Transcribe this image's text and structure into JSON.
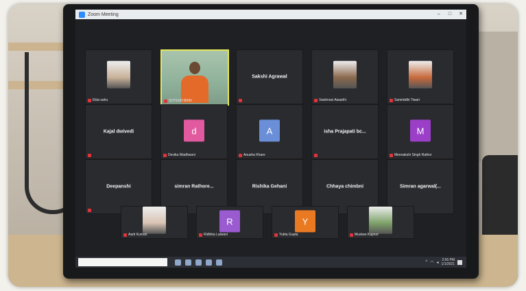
{
  "window": {
    "title": "Zoom Meeting",
    "controls": [
      "–",
      "□",
      "✕"
    ]
  },
  "participants": [
    {
      "name": "Ekta sahu",
      "type": "photo",
      "color": "#c9b29a"
    },
    {
      "name": "SOTESH BAIN",
      "type": "video",
      "active": true
    },
    {
      "name": "Sakshi Agrawal",
      "type": "name"
    },
    {
      "name": "Vaishnavi Awasthi",
      "type": "photo",
      "color": "#8b6a4e"
    },
    {
      "name": "Samriddhi Tiwari",
      "type": "photo",
      "color": "#c86b3c"
    },
    {
      "name": "Kajal dwivedi",
      "type": "name"
    },
    {
      "name": "Devika Wadhwani",
      "type": "avatar",
      "letter": "d",
      "color": "#e15aa0"
    },
    {
      "name": "Anusha Khare",
      "type": "avatar",
      "letter": "A",
      "color": "#6a8fd8"
    },
    {
      "name": "isha Prajapati bc...",
      "type": "name"
    },
    {
      "name": "Meenakshi Singh Rathor",
      "type": "avatar",
      "letter": "M",
      "color": "#9b3fc8"
    },
    {
      "name": "Deepanshi",
      "type": "name"
    },
    {
      "name": "simran Rathore...",
      "type": "name"
    },
    {
      "name": "Rishika Gehani",
      "type": "name"
    },
    {
      "name": "Chhaya chimbni",
      "type": "name"
    },
    {
      "name": "Simran agarwal(...",
      "type": "name"
    },
    {
      "name": "Aarti Kumari",
      "type": "photo",
      "color": "#d9c3b4"
    },
    {
      "name": "Ridhika Lalwani",
      "type": "avatar",
      "letter": "R",
      "color": "#9a5bd0"
    },
    {
      "name": "Yukta Gupta",
      "type": "avatar",
      "letter": "Y",
      "color": "#ea7a22"
    },
    {
      "name": "Muskan Kapoor",
      "type": "photo",
      "color": "#7fa36b"
    }
  ],
  "taskbar": {
    "time": "2:56 PM",
    "date": "1/1/2021"
  }
}
